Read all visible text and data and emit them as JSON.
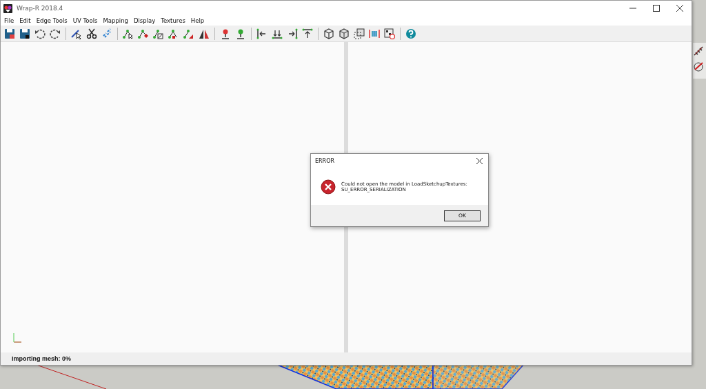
{
  "window": {
    "title": "Wrap-R 2018.4"
  },
  "menu": [
    {
      "label": "File"
    },
    {
      "label": "Edit"
    },
    {
      "label": "Edge Tools"
    },
    {
      "label": "UV Tools"
    },
    {
      "label": "Mapping"
    },
    {
      "label": "Display"
    },
    {
      "label": "Textures"
    },
    {
      "label": "Help"
    }
  ],
  "status_bar": "Importing mesh: 0%",
  "dialog": {
    "title": "ERROR",
    "message_lines": [
      "Could not open the model in LoadSketchupTextures:",
      "SU_ERROR_SERIALIZATION"
    ],
    "buttons": [
      "OK"
    ]
  }
}
